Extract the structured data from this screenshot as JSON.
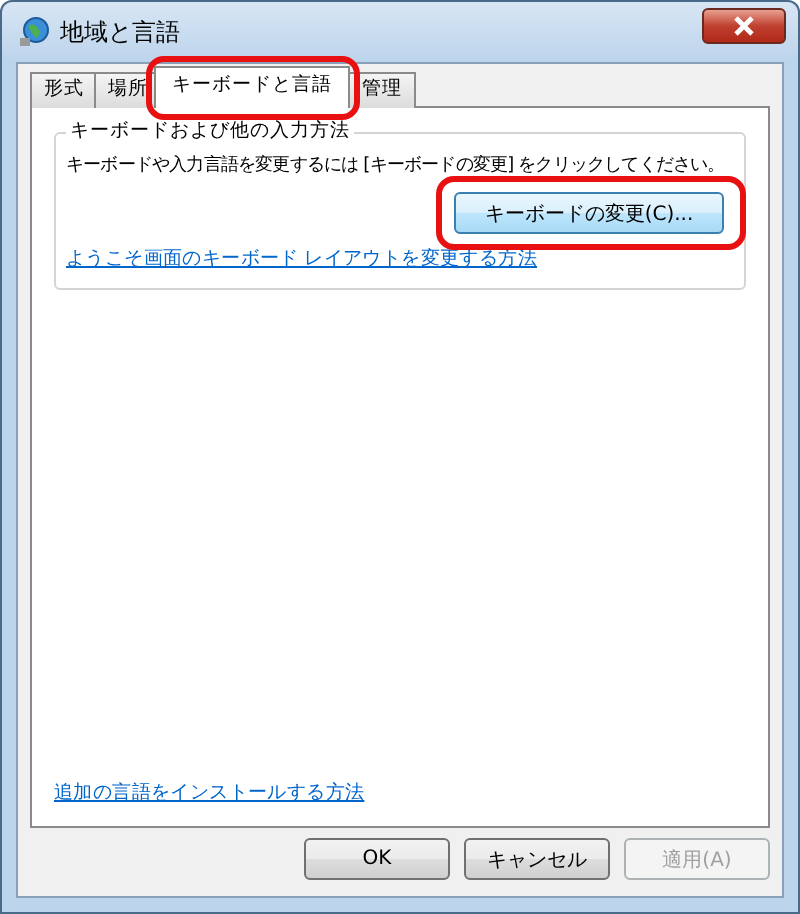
{
  "window": {
    "title": "地域と言語"
  },
  "tabs": [
    {
      "label": "形式",
      "selected": false
    },
    {
      "label": "場所",
      "selected": false
    },
    {
      "label": "キーボードと言語",
      "selected": true,
      "highlighted": true
    },
    {
      "label": "管理",
      "selected": false
    }
  ],
  "group": {
    "title": "キーボードおよび他の入力方法",
    "description": "キーボードや入力言語を変更するには [キーボードの変更] をクリックしてください。",
    "button": {
      "label": "キーボードの変更(C)...",
      "highlighted": true
    },
    "link": "ようこそ画面のキーボード レイアウトを変更する方法"
  },
  "bottom_link": "追加の言語をインストールする方法",
  "buttons": [
    {
      "label": "OK",
      "disabled": false
    },
    {
      "label": "キャンセル",
      "disabled": false
    },
    {
      "label": "適用(A)",
      "disabled": true
    }
  ]
}
